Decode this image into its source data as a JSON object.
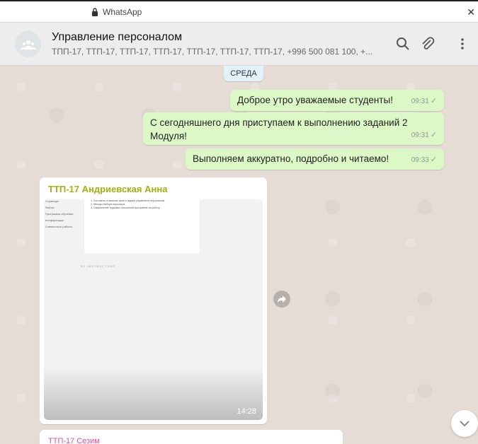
{
  "window": {
    "title": "WhatsApp"
  },
  "header": {
    "chat_name": "Управление персоналом",
    "members": "ТПП-17, ТТП-17, ТТП-17, ТТП-17, ТТП-17, ТТП-17, ТТП-17, +996 500 081 100, +..."
  },
  "day_label": "СРЕДА",
  "messages": [
    {
      "text": "Доброе утро уважаемые студенты!",
      "time": "09:31"
    },
    {
      "text": "С сегодняшнего дня приступаем к выполнению заданий 2 Модуля!",
      "time": "09:31"
    },
    {
      "text": "Выполняем аккуратно, подробно и читаемо!",
      "time": "09:33"
    }
  ],
  "image_message": {
    "sender": "ТТП-17 Андриевская Анна",
    "time": "14:28",
    "preview": {
      "sidebar": [
        "Страницы",
        "Файлы",
        "Программа обучения",
        "Конференции",
        "Совместные работы"
      ],
      "lines": [
        "1. Составить и записать цели и задачи управления персоналом.",
        "2. Методы Набора персонала",
        "3. Оформление трудовых отношений при приеме на работу"
      ],
      "footer": "BY INSTRUCTURE"
    }
  },
  "partial_message": {
    "sender": "ТТП-17 Сезим"
  },
  "colors": {
    "outgoing": "#dcf8c6",
    "chat_bg": "#e5ddd5",
    "sender_color": "#9fb20e"
  }
}
